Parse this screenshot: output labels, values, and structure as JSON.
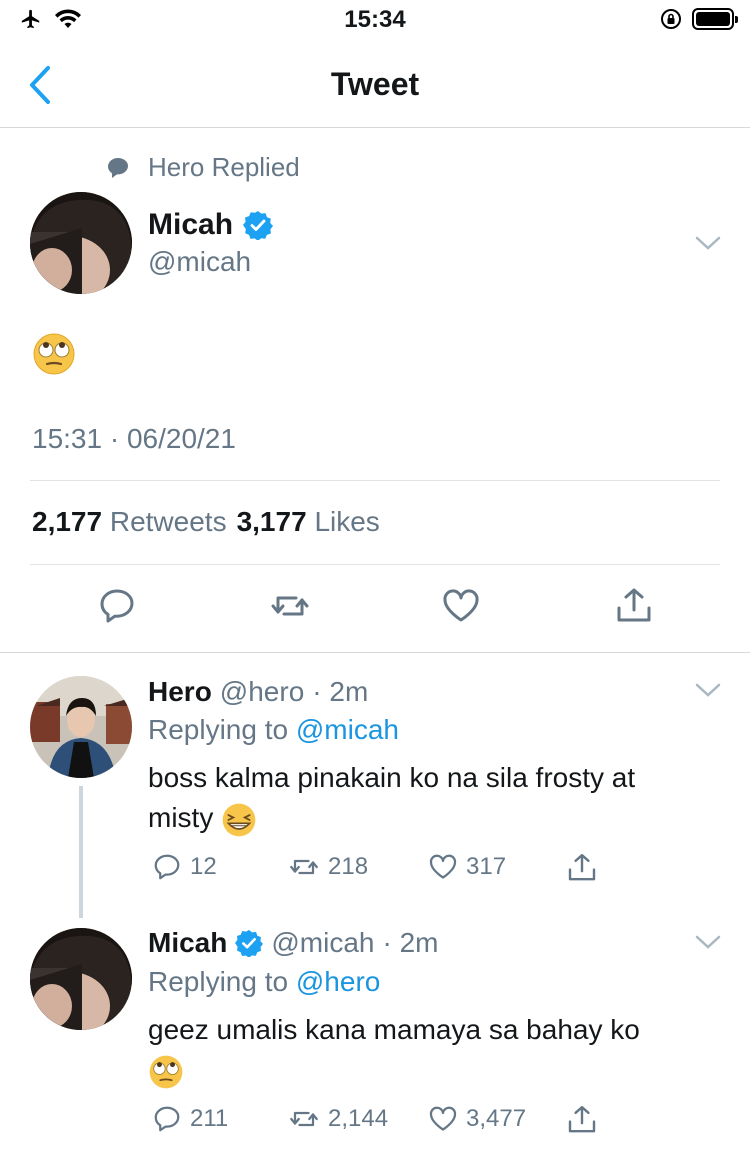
{
  "status_bar": {
    "time": "15:34"
  },
  "nav": {
    "title": "Tweet"
  },
  "main_tweet": {
    "context": "Hero Replied",
    "name": "Micah",
    "handle": "@micah",
    "content_emoji": "rolling-eyes",
    "timestamp": "15:31 · 06/20/21",
    "retweets_count": "2,177",
    "retweets_label": "Retweets",
    "likes_count": "3,177",
    "likes_label": "Likes"
  },
  "replies": [
    {
      "name": "Hero",
      "handle": "@hero",
      "time": "· 2m",
      "replying_label": "Replying to",
      "replying_to": "@micah",
      "text_line1": "boss kalma pinakain ko na sila frosty at",
      "text_line2": "misty",
      "reply_count": "12",
      "retweet_count": "218",
      "like_count": "317"
    },
    {
      "name": "Micah",
      "handle": "@micah",
      "time": "· 2m",
      "replying_label": "Replying to",
      "replying_to": "@hero",
      "text_line1": "geez umalis kana mamaya sa bahay ko",
      "reply_count": "211",
      "retweet_count": "2,144",
      "like_count": "3,477"
    }
  ],
  "colors": {
    "accent": "#1da1f2",
    "link": "#1b95e0",
    "muted": "#657786",
    "verified": "#1da1f2"
  }
}
